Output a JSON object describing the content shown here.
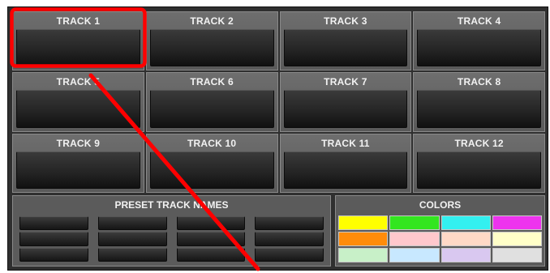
{
  "tracks": [
    {
      "label": "TRACK 1"
    },
    {
      "label": "TRACK 2"
    },
    {
      "label": "TRACK 3"
    },
    {
      "label": "TRACK 4"
    },
    {
      "label": "TRACK 5"
    },
    {
      "label": "TRACK 6"
    },
    {
      "label": "TRACK 7"
    },
    {
      "label": "TRACK 8"
    },
    {
      "label": "TRACK 9"
    },
    {
      "label": "TRACK 10"
    },
    {
      "label": "TRACK 11"
    },
    {
      "label": "TRACK 12"
    }
  ],
  "preset_panel": {
    "title": "PRESET TRACK NAMES",
    "button_count": 12
  },
  "colors_panel": {
    "title": "COLORS",
    "swatches": [
      "#ffff00",
      "#33e61f",
      "#33f0f0",
      "#ee33ee",
      "#ff8c0a",
      "#ffc8cc",
      "#ffd9c6",
      "#ffffc8",
      "#c8f0c8",
      "#c8e8ff",
      "#d9c8f0",
      "#e0e0e0"
    ]
  },
  "annotation": {
    "highlight_color": "#ff0000",
    "highlighted_item": "TRACK 1"
  }
}
